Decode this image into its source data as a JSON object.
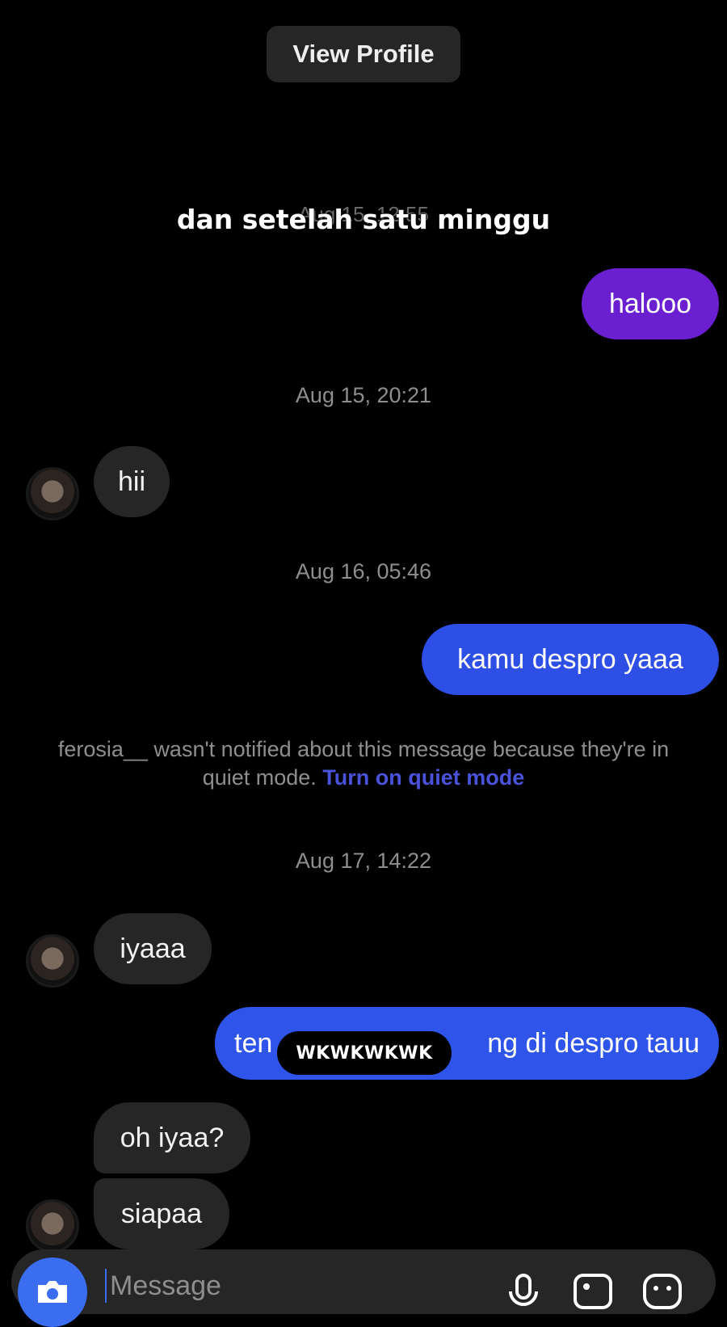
{
  "header": {
    "view_profile_label": "View Profile"
  },
  "overlay": {
    "caption": "dan setelah satu minggu"
  },
  "ghost_timestamp": "Aug 15, 12:55",
  "messages": [
    {
      "text": "halooo"
    },
    {
      "timestamp": "Aug 15, 20:21"
    },
    {
      "text": "hii"
    },
    {
      "timestamp": "Aug 16, 05:46"
    },
    {
      "text": "kamu despro yaaa"
    },
    {
      "timestamp": "Aug 17, 14:22"
    },
    {
      "text": "iyaaa"
    },
    {
      "text_left": "ten",
      "text_right": "ng di despro tauu"
    },
    {
      "text": "oh iyaa?"
    },
    {
      "text": "siapaa"
    }
  ],
  "quiet_notice": {
    "text": "ferosia__ wasn't notified about this message because they're in quiet mode.",
    "link": "Turn on quiet mode"
  },
  "overlay_label": "WKWKWKWK",
  "composer": {
    "placeholder": "Message",
    "icons": [
      "camera-icon",
      "microphone-icon",
      "gallery-icon",
      "sticker-icon"
    ]
  },
  "colors": {
    "background": "#000000",
    "incoming_bubble": "#262626",
    "outgoing_purple": "#6a1fd0",
    "outgoing_blue": "#2d4fe6",
    "link": "#4a52d9"
  }
}
